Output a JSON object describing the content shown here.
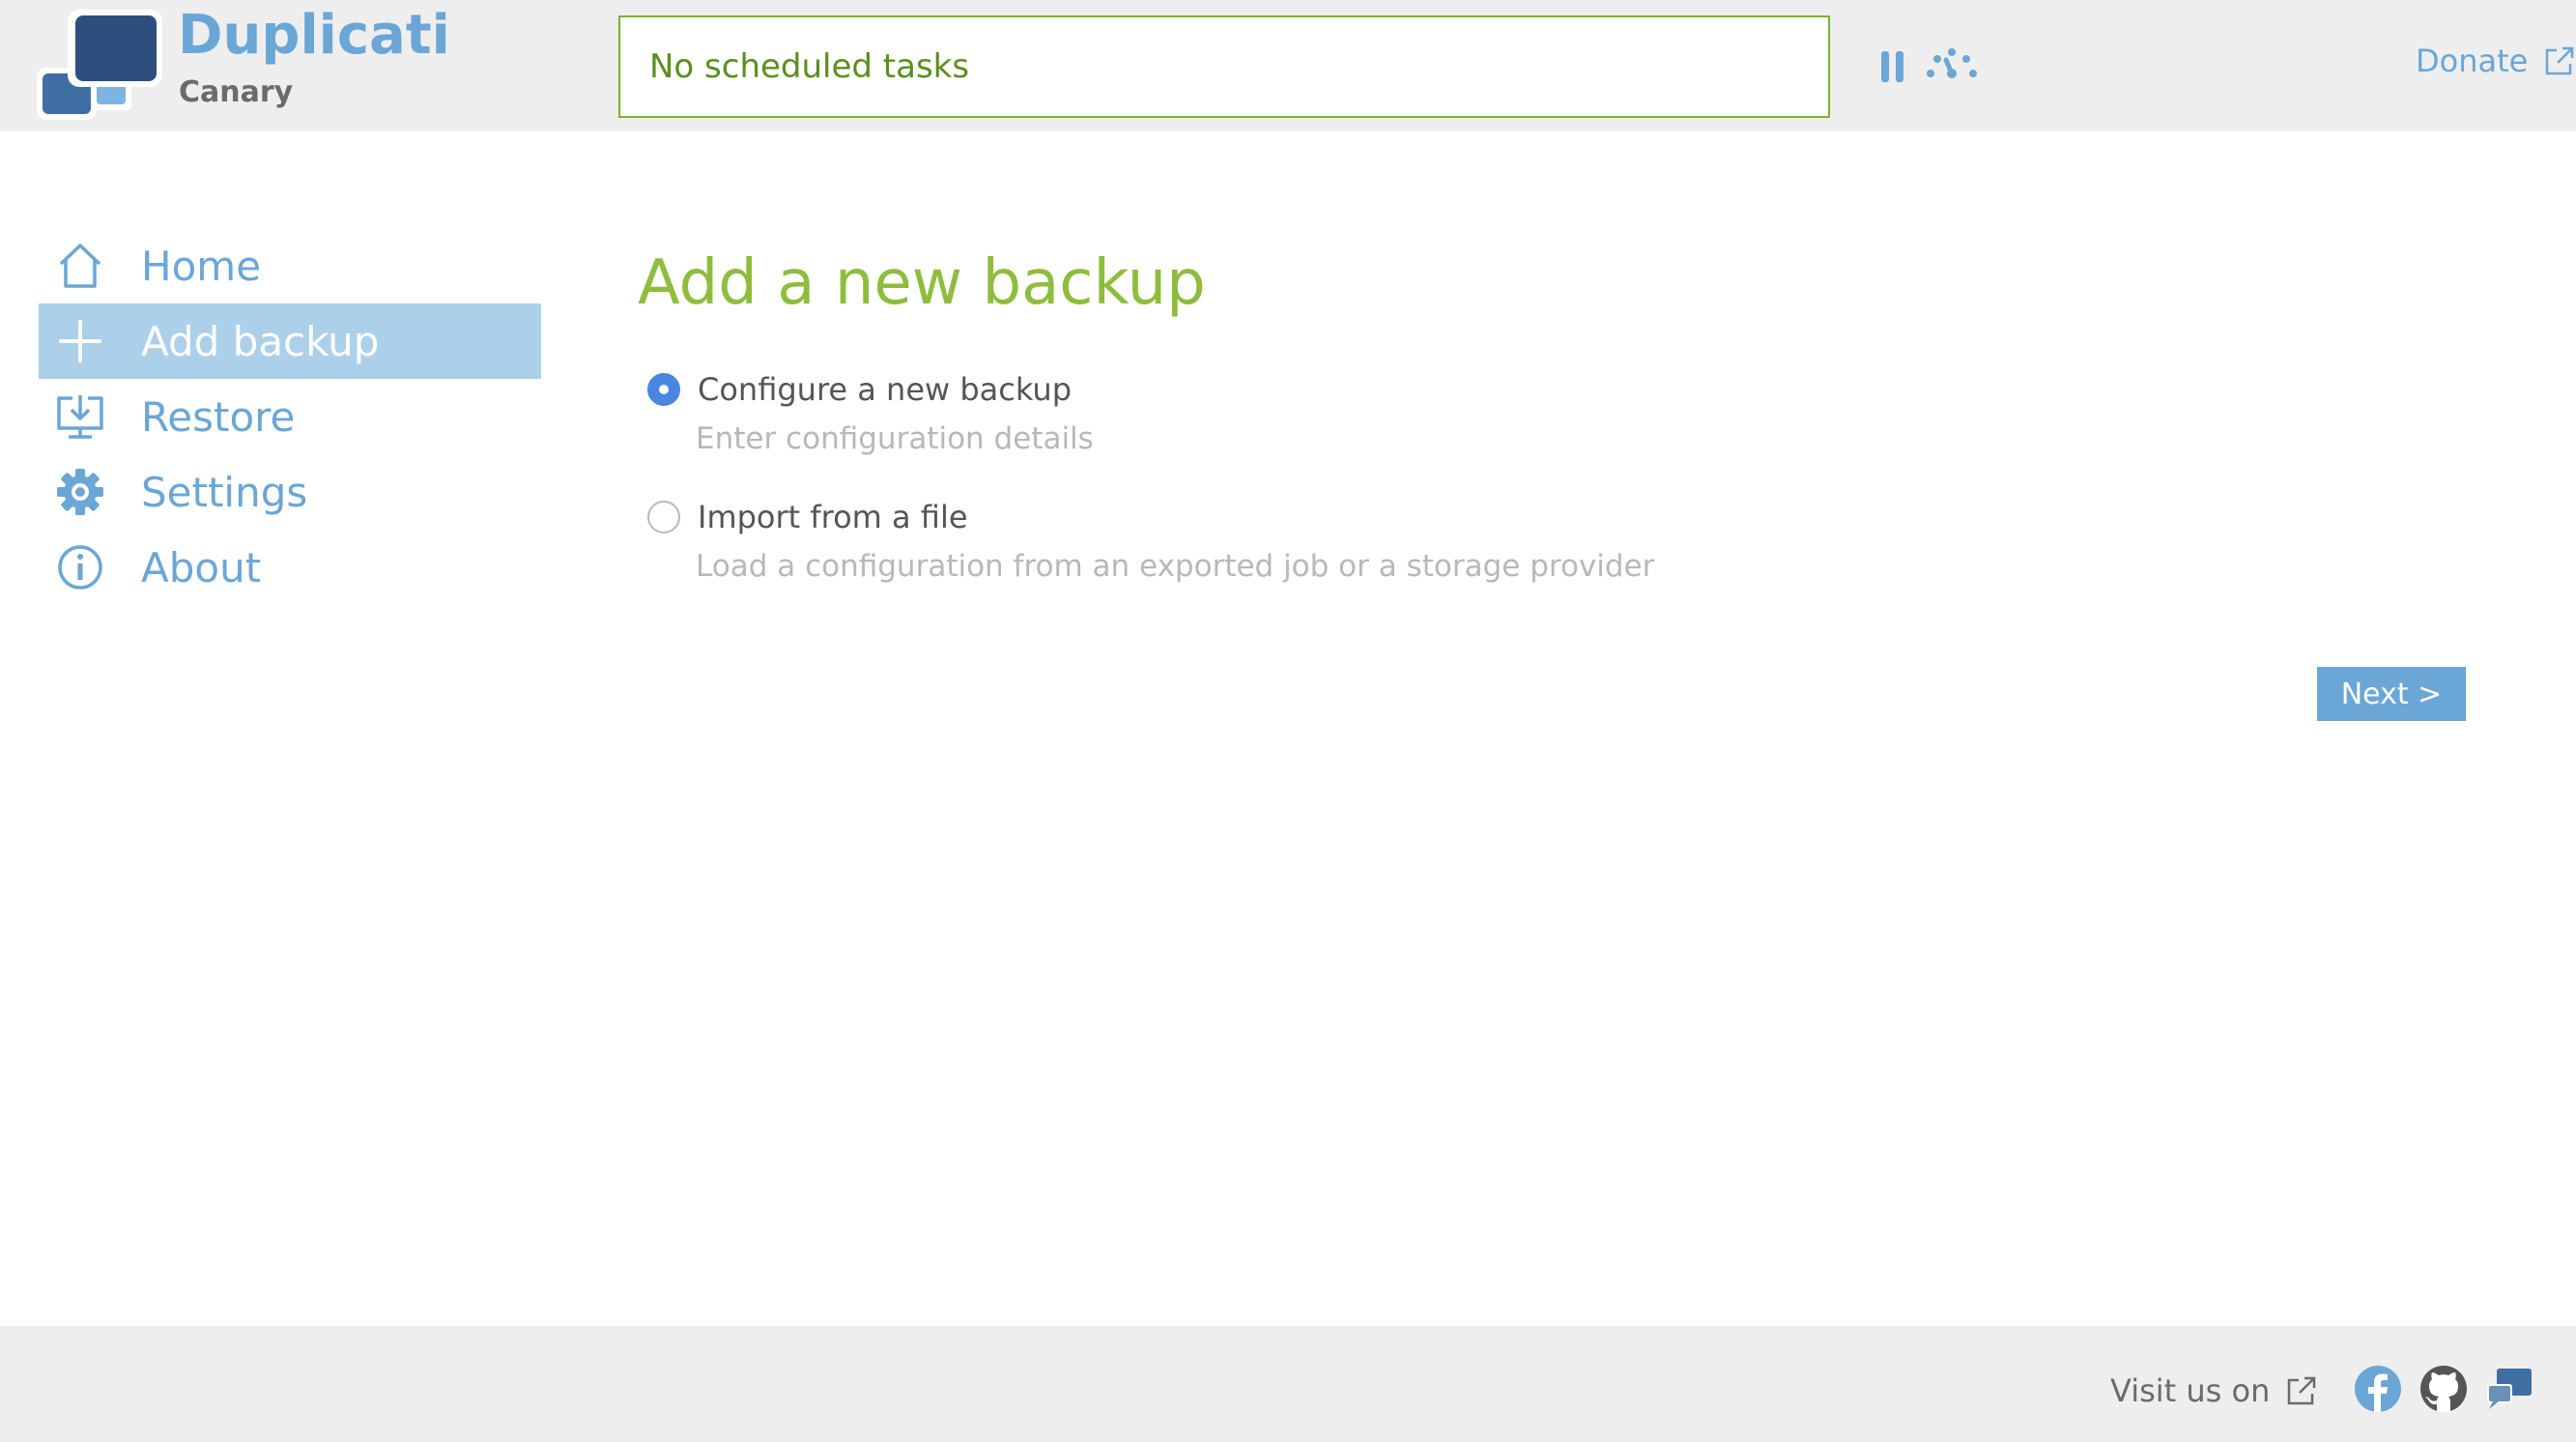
{
  "header": {
    "brand_title": "Duplicati",
    "brand_subtitle": "Canary",
    "status_text": "No scheduled tasks",
    "donate_label": "Donate",
    "icons": [
      "logo-icon",
      "pause-icon",
      "throttle-icon",
      "external-link-icon"
    ]
  },
  "sidebar": {
    "items": [
      {
        "label": "Home",
        "icon": "home-icon",
        "active": false
      },
      {
        "label": "Add backup",
        "icon": "plus-icon",
        "active": true
      },
      {
        "label": "Restore",
        "icon": "restore-icon",
        "active": false
      },
      {
        "label": "Settings",
        "icon": "gear-icon",
        "active": false
      },
      {
        "label": "About",
        "icon": "info-icon",
        "active": false
      }
    ]
  },
  "main": {
    "title": "Add a new backup",
    "options": [
      {
        "label": "Configure a new backup",
        "description": "Enter configuration details",
        "selected": true
      },
      {
        "label": "Import from a file",
        "description": "Load a configuration from an exported job or a storage provider",
        "selected": false
      }
    ],
    "next_label": "Next >"
  },
  "footer": {
    "visit_label": "Visit us on",
    "social_icons": [
      "facebook-icon",
      "github-icon",
      "forum-icon"
    ]
  },
  "colors": {
    "brand_blue": "#6aa6d6",
    "logo_dark": "#2e4e7e",
    "title_green": "#8ebd3e",
    "status_green": "#5a8f1d",
    "active_nav_bg": "#acd0ea",
    "radio_blue": "#4a86e0",
    "header_bg": "#eeeeee"
  }
}
